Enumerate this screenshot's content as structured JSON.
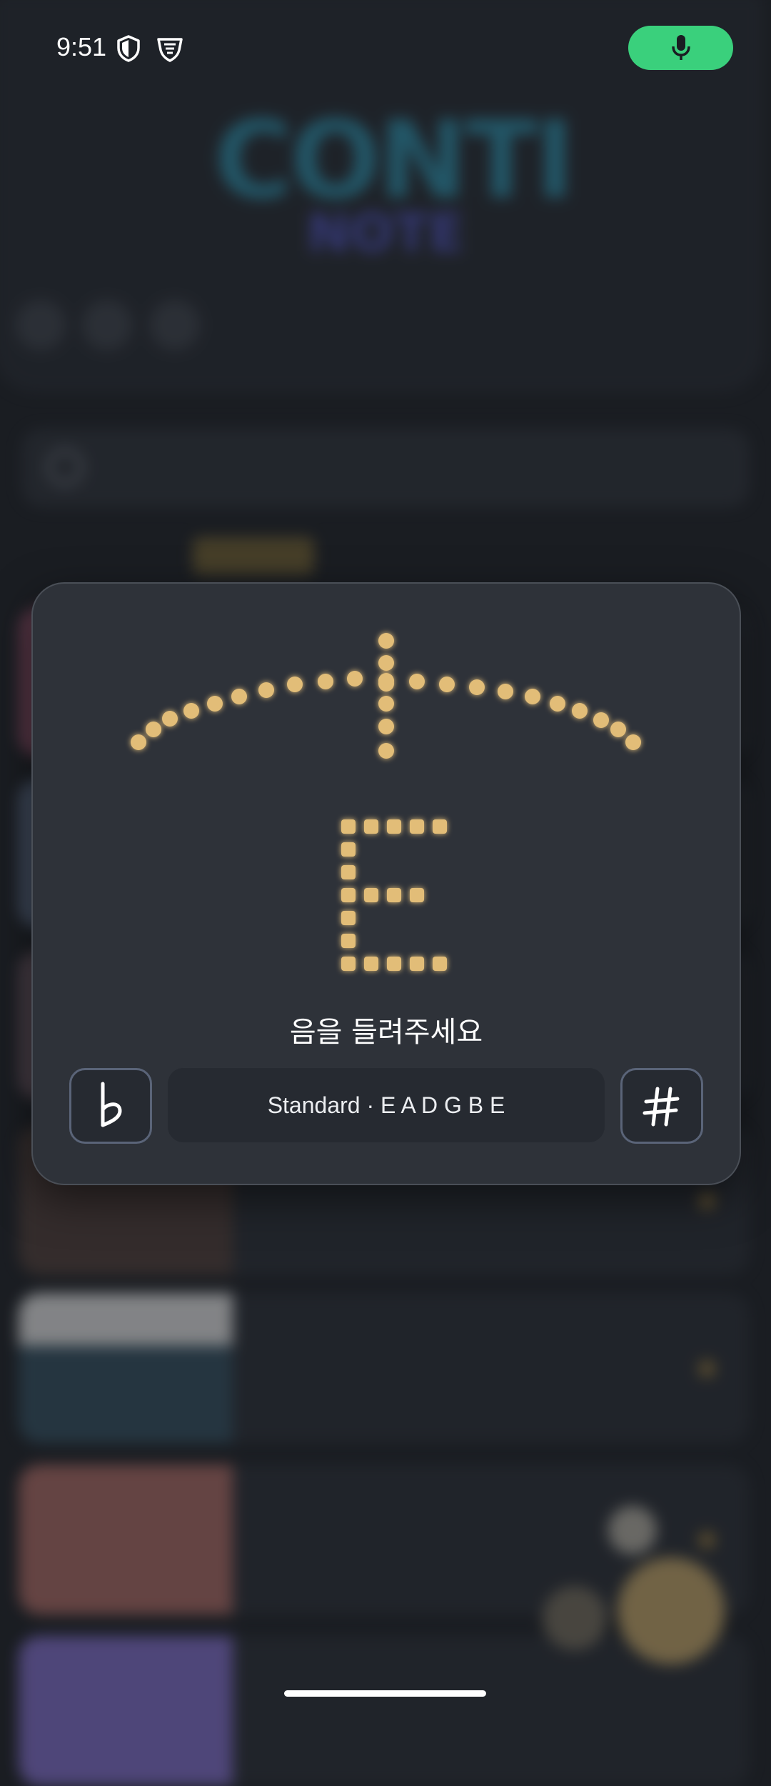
{
  "status_bar": {
    "time": "9:51",
    "icons": [
      "shield-icon",
      "vpn-shield-icon"
    ],
    "mic_color": "#3ad07c"
  },
  "tuner": {
    "note": "E",
    "message": "음을 들려주세요",
    "tuning": "Standard · E A D G B E",
    "flat_button": "flat-icon",
    "sharp_button": "sharp-icon",
    "dot_color": "#e2bd78"
  }
}
